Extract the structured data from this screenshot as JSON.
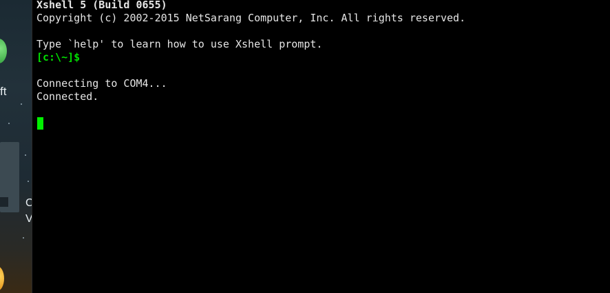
{
  "terminal": {
    "banner_title": "Xshell 5 (Build 0655)",
    "copyright": "Copyright (c) 2002-2015 NetSarang Computer, Inc. All rights reserved.",
    "help_hint": "Type `help' to learn how to use Xshell prompt.",
    "prompt": "[c:\\~]$",
    "connecting": "Connecting to COM4...",
    "connected": "Connected.",
    "cursor_color": "#00f000",
    "prompt_color": "#00e000",
    "text_color": "#e6e6e6",
    "background": "#000000"
  },
  "desktop": {
    "label_partial_1": "ft",
    "label_partial_2": "C",
    "label_partial_3": "V",
    "icons": [
      "app-icon-green",
      "app-icon-orange"
    ]
  }
}
